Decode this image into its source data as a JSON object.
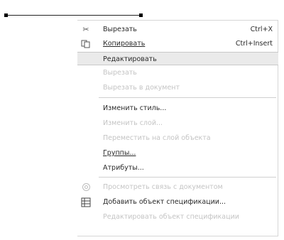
{
  "context_menu": {
    "items": [
      {
        "label": "Вырезать",
        "shortcut": "Ctrl+X",
        "icon": "scissors-icon",
        "disabled": false
      },
      {
        "label": "Копировать",
        "shortcut": "Ctrl+Insert",
        "icon": "copy-icon",
        "disabled": false
      },
      {
        "label": "Редактировать",
        "shortcut": "",
        "icon": "",
        "disabled": false,
        "highlighted": true
      },
      {
        "label": "Вырезать",
        "shortcut": "",
        "icon": "",
        "disabled": true
      },
      {
        "label": "Вырезать в документ",
        "shortcut": "",
        "icon": "",
        "disabled": true
      },
      {
        "label": "Изменить стиль...",
        "shortcut": "",
        "icon": "",
        "disabled": false
      },
      {
        "label": "Изменить слой...",
        "shortcut": "",
        "icon": "",
        "disabled": true
      },
      {
        "label": "Переместить на слой объекта",
        "shortcut": "",
        "icon": "",
        "disabled": true
      },
      {
        "label": "Группы...",
        "shortcut": "",
        "icon": "",
        "disabled": false
      },
      {
        "label": "Атрибуты...",
        "shortcut": "",
        "icon": "",
        "disabled": false
      },
      {
        "label": "Просмотреть связь с документом",
        "shortcut": "",
        "icon": "link-icon",
        "disabled": true
      },
      {
        "label": "Добавить объект спецификации...",
        "shortcut": "",
        "icon": "specification-icon",
        "disabled": false
      },
      {
        "label": "Редактировать объект спецификации",
        "shortcut": "",
        "icon": "",
        "disabled": true
      }
    ]
  }
}
